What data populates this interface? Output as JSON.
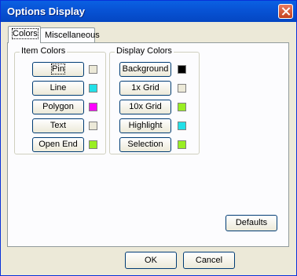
{
  "window": {
    "title": "Options Display"
  },
  "tabs": [
    {
      "label": "Colors"
    },
    {
      "label": "Miscellaneous"
    }
  ],
  "item_colors": {
    "label": "Item Colors",
    "items": [
      {
        "label": "Pin",
        "color": "#ece9d8"
      },
      {
        "label": "Line",
        "color": "#22e0e8"
      },
      {
        "label": "Polygon",
        "color": "#ff00ff"
      },
      {
        "label": "Text",
        "color": "#ece9d8"
      },
      {
        "label": "Open End",
        "color": "#99ee22"
      }
    ]
  },
  "display_colors": {
    "label": "Display Colors",
    "items": [
      {
        "label": "Background",
        "color": "#000000"
      },
      {
        "label": "1x Grid",
        "color": "#ece9d8"
      },
      {
        "label": "10x Grid",
        "color": "#99ee22"
      },
      {
        "label": "Highlight",
        "color": "#22e0e8"
      },
      {
        "label": "Selection",
        "color": "#99ee22"
      }
    ]
  },
  "buttons": {
    "defaults": "Defaults",
    "ok": "OK",
    "cancel": "Cancel"
  }
}
